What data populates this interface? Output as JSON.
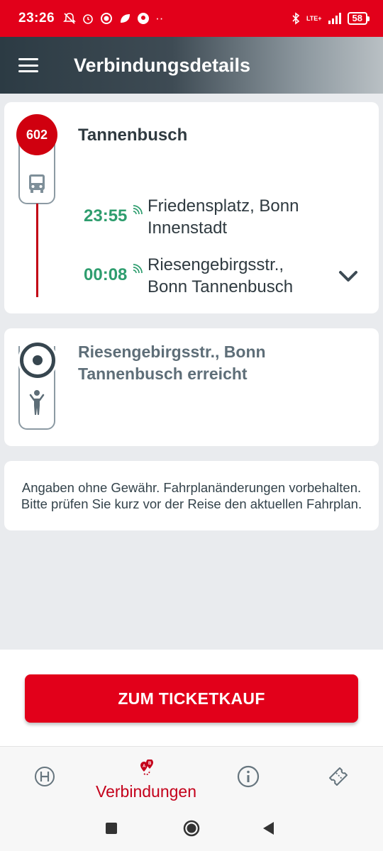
{
  "status_bar": {
    "time": "23:26",
    "battery": "58",
    "network": "LTE+"
  },
  "app_bar": {
    "title": "Verbindungsdetails",
    "menu_icon": "hamburger-menu-icon"
  },
  "leg": {
    "line": "602",
    "destination": "Tannenbusch",
    "transport_icon": "bus-icon",
    "stops": [
      {
        "time": "23:55",
        "name_line1": "Friedensplatz, Bonn",
        "name_line2": "Innenstadt"
      },
      {
        "time": "00:08",
        "name_line1": "Riesengebirgsstr.,",
        "name_line2": "Bonn Tannenbusch"
      }
    ],
    "expand_icon": "chevron-down-icon"
  },
  "arrival": {
    "line1": "Riesengebirgsstr., Bonn",
    "line2": "Tannenbusch erreicht",
    "icon": "walking-person-icon"
  },
  "disclaimer": "Angaben ohne Gewähr. Fahrplanänderungen vorbehalten. Bitte prüfen Sie kurz vor der Reise den aktuellen Fahrplan.",
  "ticket_button": "ZUM TICKETKAUF",
  "bottom_nav": [
    {
      "icon": "stop-h-icon",
      "label": ""
    },
    {
      "icon": "route-ab-icon",
      "label": "Verbindungen"
    },
    {
      "icon": "info-icon",
      "label": ""
    },
    {
      "icon": "ticket-icon",
      "label": ""
    }
  ],
  "colors": {
    "brand_red": "#e2001a",
    "realtime_green": "#2e9d6e",
    "dark_slate": "#2f3a40"
  }
}
